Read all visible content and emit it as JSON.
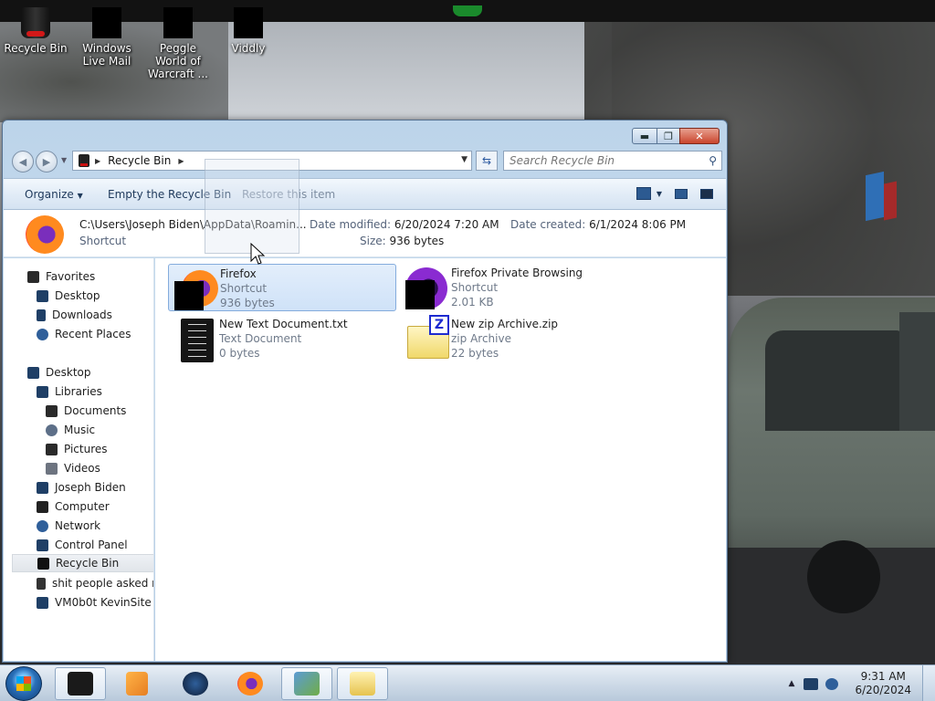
{
  "desktop": {
    "icons": [
      {
        "label": "Recycle Bin"
      },
      {
        "label": "Windows Live Mail"
      },
      {
        "label": "Peggle World of Warcraft ..."
      },
      {
        "label": "Viddly"
      }
    ]
  },
  "window": {
    "title_buttons": {
      "minimize": "▬",
      "maximize": "❐",
      "close": "✕"
    },
    "address": {
      "crumbs": [
        "Recycle Bin"
      ],
      "separator": "▶",
      "dropdown": "▼"
    },
    "search": {
      "placeholder": "Search Recycle Bin"
    },
    "commands": {
      "organize": "Organize",
      "organize_drop": "▼",
      "empty": "Empty the Recycle Bin",
      "restore": "Restore this item",
      "view_drop": "▼"
    },
    "details": {
      "path": "C:\\Users\\Joseph Biden\\AppData\\Roamin...",
      "type": "Shortcut",
      "date_modified_label": "Date modified:",
      "date_modified": "6/20/2024 7:20 AM",
      "size_label": "Size:",
      "size": "936 bytes",
      "date_created_label": "Date created:",
      "date_created": "6/1/2024 8:06 PM"
    },
    "nav": {
      "items": [
        {
          "label": "Favorites"
        },
        {
          "label": "Desktop"
        },
        {
          "label": "Downloads"
        },
        {
          "label": "Recent Places"
        },
        {
          "label": "Desktop"
        },
        {
          "label": "Libraries"
        },
        {
          "label": "Documents"
        },
        {
          "label": "Music"
        },
        {
          "label": "Pictures"
        },
        {
          "label": "Videos"
        },
        {
          "label": "Joseph Biden"
        },
        {
          "label": "Computer"
        },
        {
          "label": "Network"
        },
        {
          "label": "Control Panel"
        },
        {
          "label": "Recycle Bin"
        },
        {
          "label": "shit people asked m"
        },
        {
          "label": "VM0b0t KevinSite"
        }
      ]
    },
    "files": [
      {
        "name": "Firefox",
        "type": "Shortcut",
        "size": "936 bytes"
      },
      {
        "name": "Firefox Private Browsing",
        "type": "Shortcut",
        "size": "2.01 KB"
      },
      {
        "name": "New Text Document.txt",
        "type": "Text Document",
        "size": "0 bytes"
      },
      {
        "name": "New zip Archive.zip",
        "type": "zip Archive",
        "size": "22 bytes",
        "badge": "Z"
      }
    ]
  },
  "taskbar": {
    "tray_arrow": "▲",
    "time": "9:31 AM",
    "date": "6/20/2024"
  }
}
